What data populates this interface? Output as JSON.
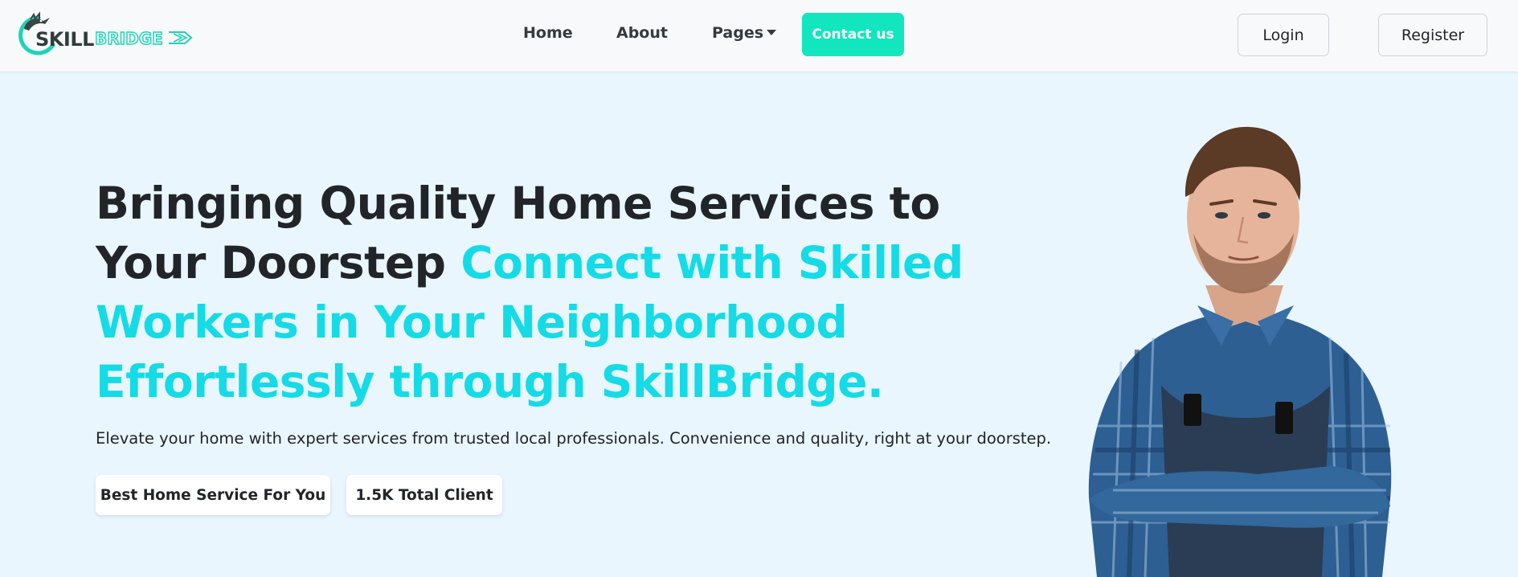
{
  "brand": {
    "logo_part1": "SKILL",
    "logo_part2": "BRIDGE",
    "accent_color": "#11e6be",
    "highlight_color": "#14dbe6"
  },
  "nav": {
    "home": "Home",
    "about": "About",
    "pages": "Pages",
    "contact": "Contact us",
    "login": "Login",
    "register": "Register"
  },
  "hero": {
    "title_dark": "Bringing Quality Home Services to Your Doorstep",
    "title_accent": "Connect with Skilled Workers in Your Neighborhood Effortlessly through SkillBridge.",
    "subtitle": "Elevate your home with expert services from trusted local professionals. Convenience and quality, right at your doorstep.",
    "badge_1": "Best Home Service For You",
    "badge_2": "1.5K Total Client"
  },
  "icons": {
    "logo": "skillbridge-logo-icon",
    "caret": "caret-down-icon"
  }
}
